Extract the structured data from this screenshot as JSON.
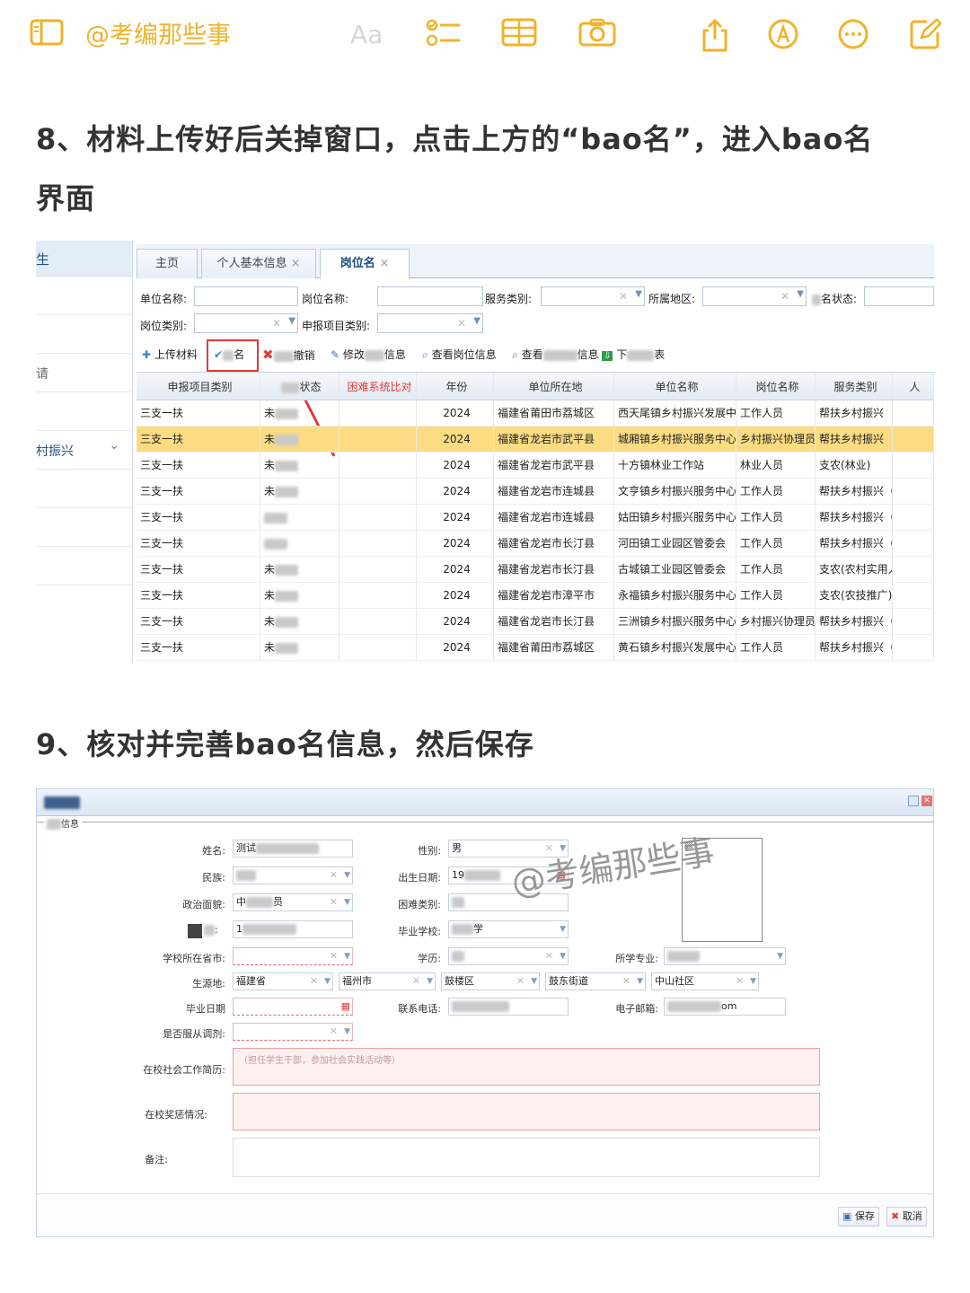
{
  "topbar": {
    "title": "@考编那些事",
    "font_btn": "Aa",
    "icons": [
      "sidebar-icon",
      "checklist-icon",
      "table-icon",
      "camera-icon",
      "share-icon",
      "markup-icon",
      "more-icon",
      "compose-icon"
    ],
    "accent": "#f0b32b"
  },
  "step8": {
    "line1": "8、材料上传好后关掉窗口，点击上方的“bao名”，进入bao名",
    "line2": "界面"
  },
  "step9": {
    "text": "9、核对并完善bao名信息，然后保存"
  },
  "shot1": {
    "left_nav": {
      "header": "生",
      "item_apply": "请",
      "item_rural": "村振兴",
      "chevron": "⌄"
    },
    "tabs": [
      {
        "label": "主页"
      },
      {
        "label": "个人基本信息"
      },
      {
        "label": "岗位名"
      }
    ],
    "tab_close": "×",
    "filters": {
      "unit_name": "单位名称:",
      "post_name": "岗位名称:",
      "service_type": "服务类别:",
      "region": "所属地区:",
      "status": "名状态:",
      "post_category": "岗位类别:",
      "project_category": "申报项目类别:"
    },
    "toolbar": {
      "upload": "上传材料",
      "apply": "名",
      "revoke": "撤销",
      "edit": "修改",
      "info": "信息",
      "view_post": "查看岗位信息",
      "view_other": "查看",
      "info2": "信息",
      "download": "下",
      "table": "表"
    },
    "columns": [
      "申报项目类别",
      "状态",
      "困难系统比对",
      "年份",
      "单位所在地",
      "单位名称",
      "岗位名称",
      "服务类别",
      "人"
    ],
    "rows": [
      {
        "project": "三支一扶",
        "status": "未",
        "year": "2024",
        "location": "福建省莆田市荔城区",
        "unit": "西天尾镇乡村振兴发展中",
        "post": "工作人员",
        "service": "帮扶乡村振兴"
      },
      {
        "project": "三支一扶",
        "status": "未",
        "year": "2024",
        "location": "福建省龙岩市武平县",
        "unit": "城厢镇乡村振兴服务中心",
        "post": "乡村振兴协理员",
        "service": "帮扶乡村振兴"
      },
      {
        "project": "三支一扶",
        "status": "未",
        "year": "2024",
        "location": "福建省龙岩市武平县",
        "unit": "十方镇林业工作站",
        "post": "林业人员",
        "service": "支农(林业)"
      },
      {
        "project": "三支一扶",
        "status": "未",
        "year": "2024",
        "location": "福建省龙岩市连城县",
        "unit": "文亨镇乡村振兴服务中心",
        "post": "工作人员",
        "service": "帮扶乡村振兴（"
      },
      {
        "project": "三支一扶",
        "status": "",
        "year": "2024",
        "location": "福建省龙岩市连城县",
        "unit": "姑田镇乡村振兴服务中心",
        "post": "工作人员",
        "service": "帮扶乡村振兴（"
      },
      {
        "project": "三支一扶",
        "status": "",
        "year": "2024",
        "location": "福建省龙岩市长汀县",
        "unit": "河田镇工业园区管委会",
        "post": "工作人员",
        "service": "帮扶乡村振兴（"
      },
      {
        "project": "三支一扶",
        "status": "未",
        "year": "2024",
        "location": "福建省龙岩市长汀县",
        "unit": "古城镇工业园区管委会",
        "post": "工作人员",
        "service": "支农(农村实用人"
      },
      {
        "project": "三支一扶",
        "status": "未",
        "year": "2024",
        "location": "福建省龙岩市漳平市",
        "unit": "永福镇乡村振兴服务中心",
        "post": "工作人员",
        "service": "支农(农技推广)"
      },
      {
        "project": "三支一扶",
        "status": "未",
        "year": "2024",
        "location": "福建省龙岩市长汀县",
        "unit": "三洲镇乡村振兴服务中心",
        "post": "乡村振兴协理员",
        "service": "帮扶乡村振兴（"
      },
      {
        "project": "三支一扶",
        "status": "未",
        "year": "2024",
        "location": "福建省莆田市荔城区",
        "unit": "黄石镇乡村振兴发展中心",
        "post": "工作人员",
        "service": "帮扶乡村振兴（"
      }
    ],
    "selected_row_color": "#fbdc83"
  },
  "shot2": {
    "section": "信息",
    "labels": {
      "name": "姓名:",
      "gender": "性别:",
      "ethnic": "民族:",
      "birth": "出生日期:",
      "political": "政治面貌:",
      "hardship": "困难类别:",
      "id_sep": ":",
      "school": "毕业学校:",
      "school_city": "学校所在省市:",
      "edu": "学历:",
      "major": "所学专业:",
      "origin": "生源地:",
      "grad_date": "毕业日期",
      "phone": "联系电话:",
      "email": "电子邮箱:",
      "adjust": "是否服从调剂:",
      "work": "在校社会工作简历:",
      "award": "在校奖惩情况:",
      "note": "备注:"
    },
    "values": {
      "name": "测试",
      "gender": "男",
      "birth": "19",
      "political_a": "中",
      "political_b": "员",
      "id_num": "1",
      "school_a": "",
      "school_b": "学",
      "province": "福建省",
      "city": "福州市",
      "district": "鼓楼区",
      "street": "鼓东街道",
      "community": "中山社区",
      "email_tail": "om"
    },
    "work_placeholder": "（担任学生干部，参加社会实践活动等）",
    "buttons": {
      "save": "保存",
      "cancel": "取消"
    },
    "watermark": "@考编那些事"
  }
}
